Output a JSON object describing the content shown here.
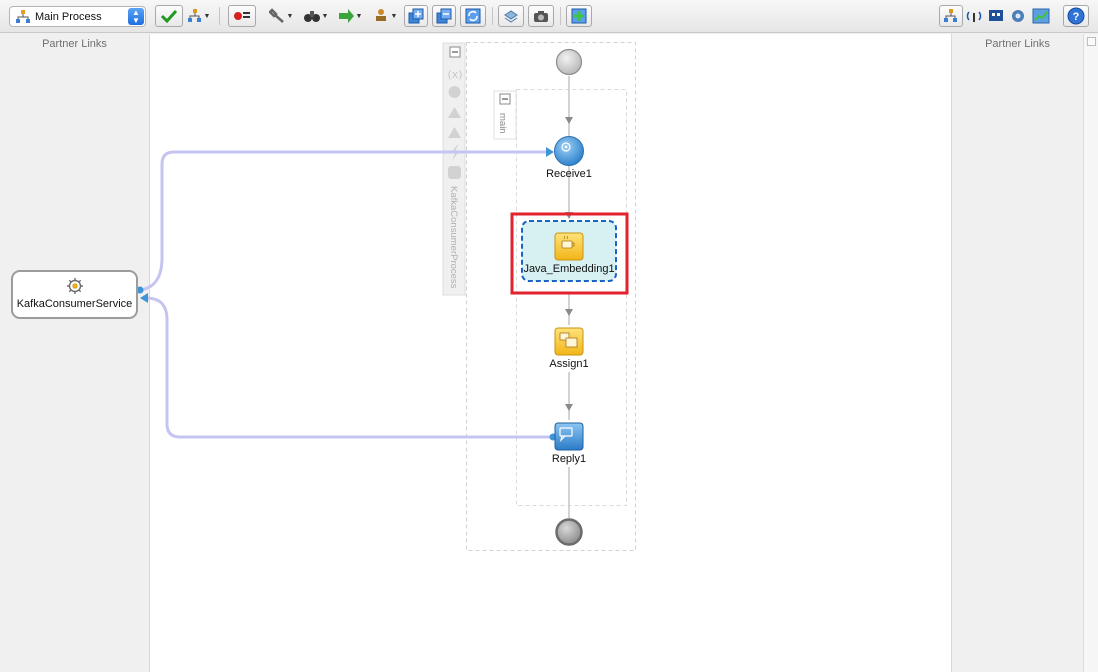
{
  "toolbar": {
    "process_select": "Main Process"
  },
  "partner_links": {
    "left_title": "Partner Links",
    "right_title": "Partner Links",
    "service_name": "KafkaConsumerService"
  },
  "process": {
    "name": "KafkaConsumerProcess",
    "sequence_label": "main",
    "activities": {
      "receive": "Receive1",
      "java": "Java_Embedding1",
      "assign": "Assign1",
      "reply": "Reply1"
    }
  },
  "colors": {
    "link_line": "#c5c4f0",
    "highlight": "#e2222c",
    "selection": "#1b62c9",
    "accent_blue": "#3f94d6",
    "activity_yellow": "#f7c62b"
  },
  "icons": {
    "validate": "check-icon",
    "help": "help-icon"
  }
}
